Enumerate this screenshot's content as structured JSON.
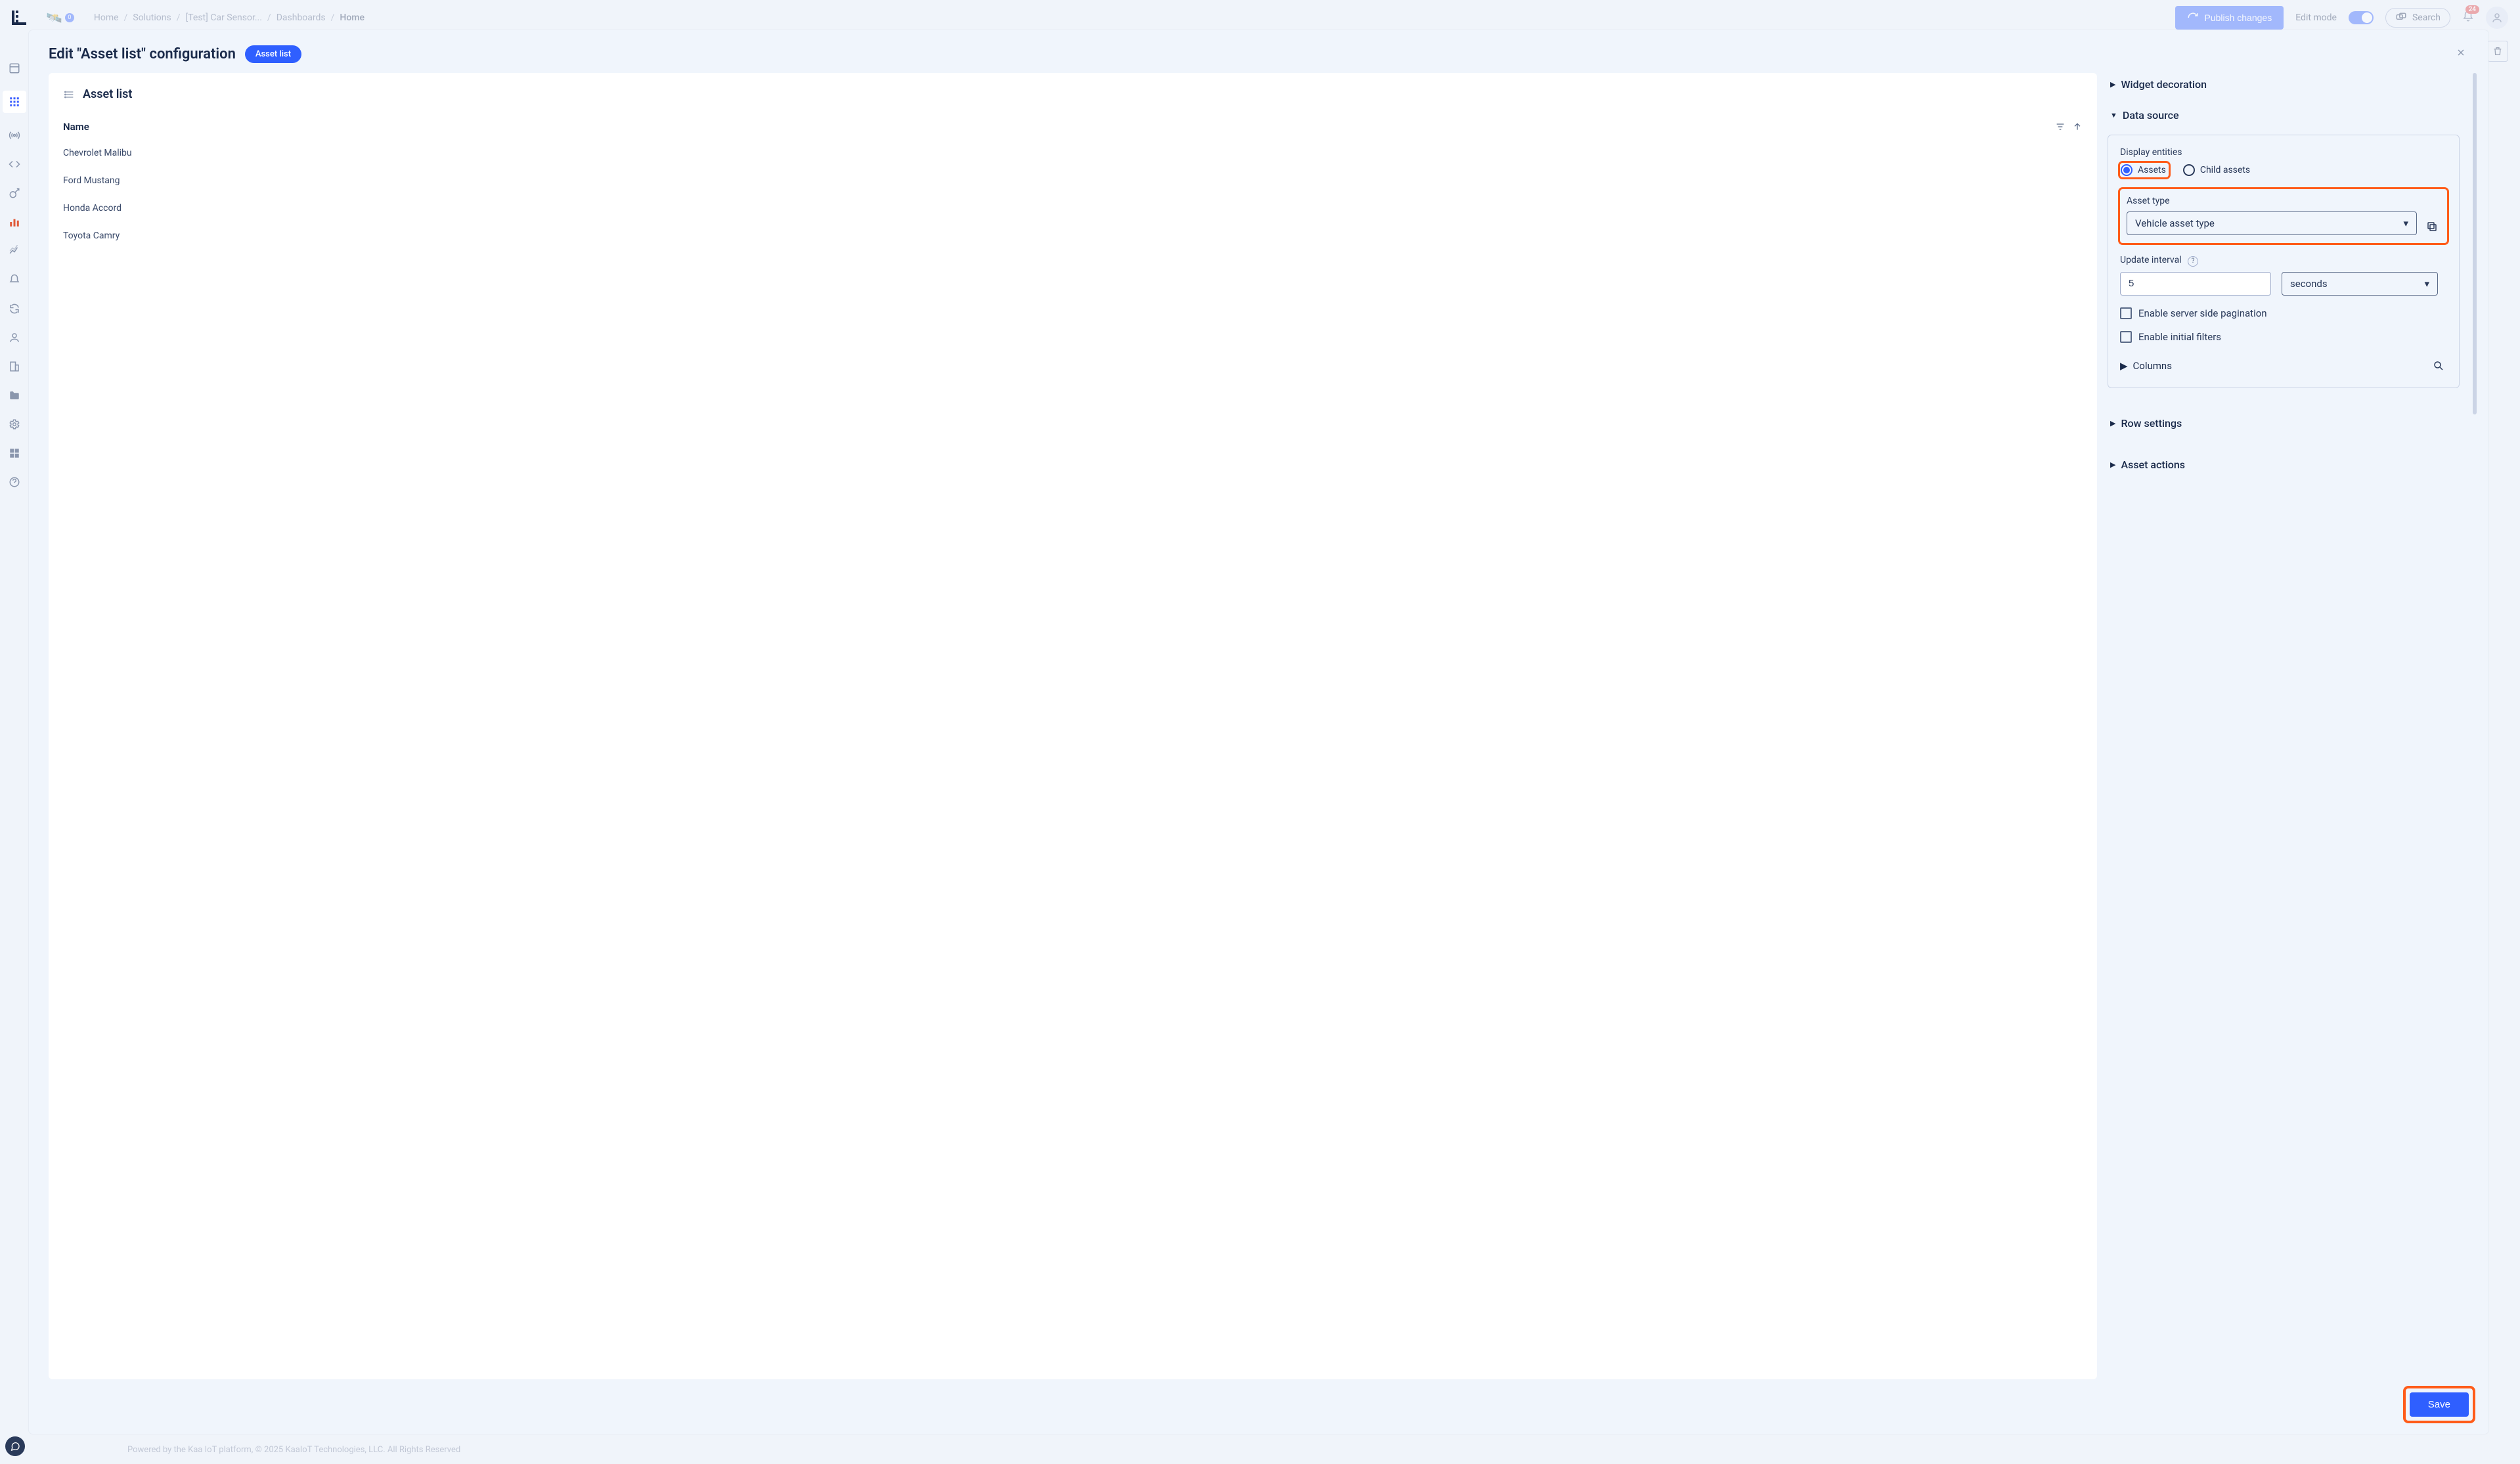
{
  "topbar": {
    "breadcrumb": [
      "Home",
      "Solutions",
      "[Test] Car Sensor...",
      "Dashboards",
      "Home"
    ],
    "publish_label": "Publish changes",
    "edit_mode_label": "Edit mode",
    "search_label": "Search",
    "notification_count": "24"
  },
  "footer": "Powered by the Kaa IoT platform, © 2025 KaaIoT Technologies, LLC. All Rights Reserved",
  "modal": {
    "title": "Edit \"Asset list\" configuration",
    "chip": "Asset list",
    "save_label": "Save"
  },
  "preview": {
    "widget_title": "Asset list",
    "column_header": "Name",
    "rows": [
      "Chevrolet Malibu",
      "Ford Mustang",
      "Honda Accord",
      "Toyota Camry"
    ]
  },
  "config": {
    "section_decoration": "Widget decoration",
    "section_data_source": "Data source",
    "section_row_settings": "Row settings",
    "section_asset_actions": "Asset actions",
    "display_entities_label": "Display entities",
    "radio_assets": "Assets",
    "radio_child_assets": "Child assets",
    "asset_type_label": "Asset type",
    "asset_type_value": "Vehicle asset type",
    "update_interval_label": "Update interval",
    "update_interval_value": "5",
    "update_interval_unit": "seconds",
    "checkbox_pagination": "Enable server side pagination",
    "checkbox_filters": "Enable initial filters",
    "columns_label": "Columns"
  }
}
